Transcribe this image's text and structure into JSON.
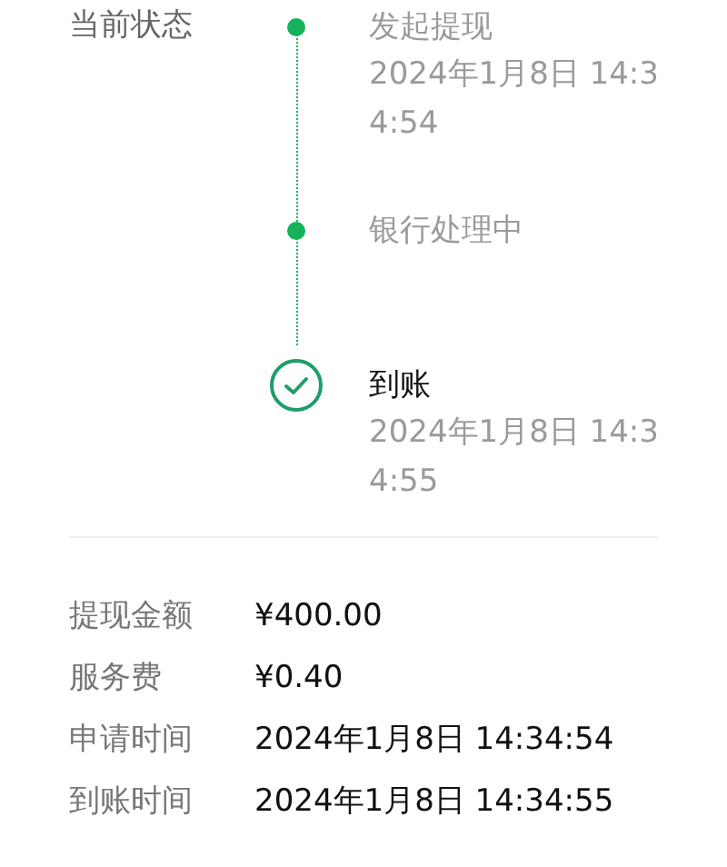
{
  "status_label": "当前状态",
  "steps": [
    {
      "kind": "dot",
      "title": "发起提现",
      "time": "2024年1月8日 14:34:54",
      "current": false
    },
    {
      "kind": "dot",
      "title": "银行处理中",
      "current": false
    },
    {
      "kind": "check",
      "title": "到账",
      "time": "2024年1月8日 14:34:55",
      "current": true
    }
  ],
  "details": [
    {
      "label": "提现金额",
      "value": "¥400.00"
    },
    {
      "label": "服务费",
      "value": "¥0.40"
    },
    {
      "label": "申请时间",
      "value": "2024年1月8日 14:34:54"
    },
    {
      "label": "到账时间",
      "value": "2024年1月8日 14:34:55"
    }
  ]
}
